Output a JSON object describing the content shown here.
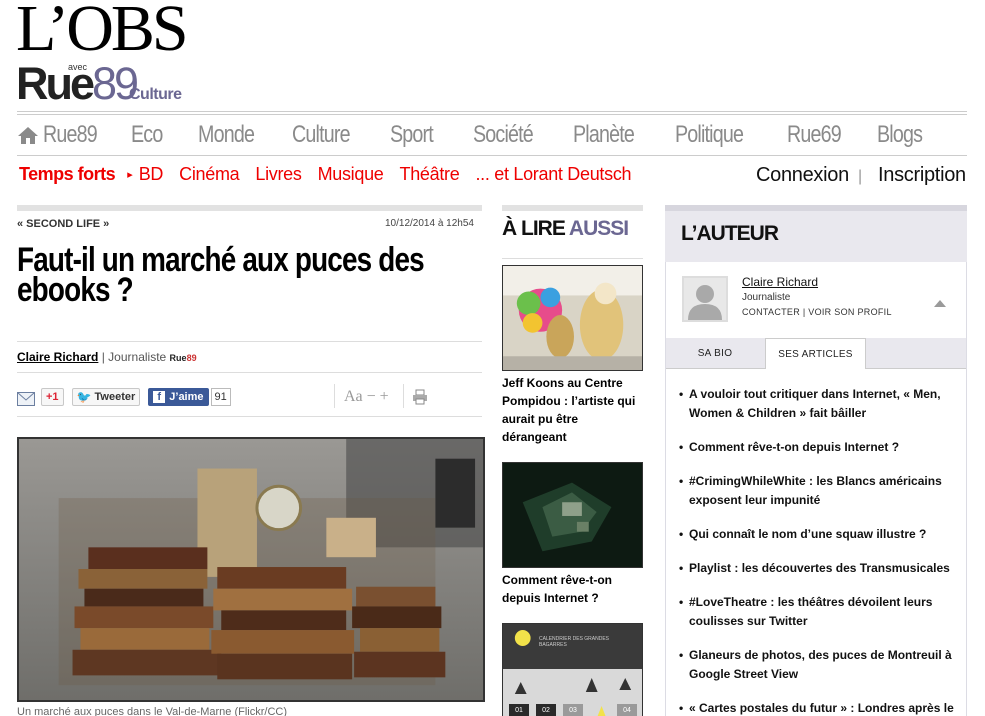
{
  "logo": {
    "obs": "L’OBS",
    "avec": "avec",
    "rue": "Rue",
    "rue_num": "89",
    "section": "Culture"
  },
  "main_nav": [
    {
      "label": "Rue89"
    },
    {
      "label": "Eco"
    },
    {
      "label": "Monde"
    },
    {
      "label": "Culture"
    },
    {
      "label": "Sport"
    },
    {
      "label": "Société"
    },
    {
      "label": "Planète"
    },
    {
      "label": "Politique"
    },
    {
      "label": "Rue69"
    },
    {
      "label": "Blogs"
    }
  ],
  "sub_nav": {
    "highlight": "Temps forts",
    "items": [
      "BD",
      "Cinéma",
      "Livres",
      "Musique",
      "Théâtre",
      "... et Lorant Deutsch"
    ]
  },
  "account": {
    "login": "Connexion",
    "separator": "|",
    "signup": "Inscription"
  },
  "article": {
    "rubric": "« SECOND LIFE »",
    "date": "10/12/2014 à 12h54",
    "title": "Faut-il un marché aux puces des ebooks ?",
    "author": "Claire Richard",
    "role": "| Journaliste",
    "source_a": "Rue",
    "source_b": "89",
    "gplus": "+1",
    "tweet": "Tweeter",
    "like": "J’aime",
    "like_count": "91",
    "font_controls": "Aa − +",
    "caption": "Un marché aux puces dans le Val-de-Marne (Flickr/CC)"
  },
  "alire": {
    "title_a": "À LIRE",
    "title_b": "AUSSI",
    "items": [
      {
        "caption": "Jeff Koons au Centre Pompidou : l’artiste qui aurait pu être dérangeant"
      },
      {
        "caption": "Comment rêve-t-on depuis Internet ?"
      }
    ],
    "calendar_title": "CALENDRIER DES GRANDES BAGARRES",
    "calendar_days": [
      "01",
      "02",
      "03",
      "04"
    ]
  },
  "author_box": {
    "title": "L’AUTEUR",
    "name": "Claire Richard",
    "role": "Journaliste",
    "links": "CONTACTER | VOIR SON PROFIL",
    "tabs": [
      "SA BIO",
      "SES ARTICLES"
    ],
    "articles": [
      "A vouloir tout critiquer dans Internet, « Men, Women & Children » fait bâiller",
      "Comment rêve-t-on depuis Internet ?",
      "#CrimingWhileWhite : les Blancs américains exposent leur impunité",
      "Qui connaît le nom d’une squaw illustre ?",
      "Playlist : les découvertes des Transmusicales",
      "#LoveTheatre : les théâtres dévoilent leurs coulisses sur Twitter",
      "Glaneurs de photos, des puces de Montreuil à Google Street View",
      "« Cartes postales du futur » : Londres après le"
    ]
  },
  "colors": {
    "accent_red": "#e00000",
    "brand_purple": "#6b6792",
    "nav_gray": "#8a8a8a"
  }
}
